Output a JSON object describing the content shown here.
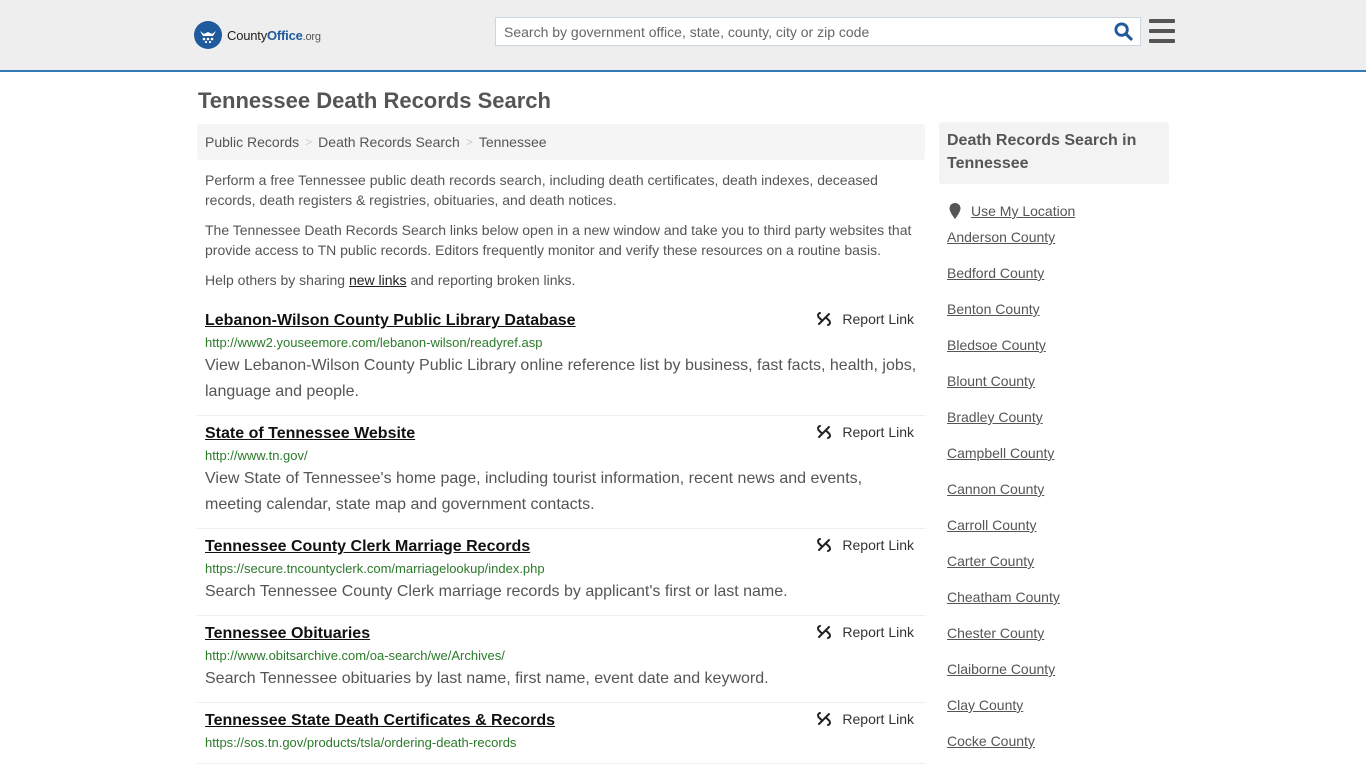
{
  "header": {
    "logo": {
      "name": "County",
      "bold": "Office",
      "tld": ".org"
    },
    "search": {
      "placeholder": "Search by government office, state, county, city or zip code",
      "value": ""
    }
  },
  "page_title": "Tennessee Death Records Search",
  "breadcrumb": [
    {
      "label": "Public Records"
    },
    {
      "label": "Death Records Search"
    },
    {
      "label": "Tennessee"
    }
  ],
  "intro": {
    "p1": "Perform a free Tennessee public death records search, including death certificates, death indexes, deceased records, death registers & registries, obituaries, and death notices.",
    "p2": "The Tennessee Death Records Search links below open in a new window and take you to third party websites that provide access to TN public records. Editors frequently monitor and verify these resources on a routine basis.",
    "p3_before": "Help others by sharing ",
    "p3_link": "new links",
    "p3_after": " and reporting broken links."
  },
  "report_label": "Report Link",
  "results": [
    {
      "title": "Lebanon-Wilson County Public Library Database",
      "url": "http://www2.youseemore.com/lebanon-wilson/readyref.asp",
      "desc": "View Lebanon-Wilson County Public Library online reference list by business, fast facts, health, jobs, language and people."
    },
    {
      "title": "State of Tennessee Website",
      "url": "http://www.tn.gov/",
      "desc": "View State of Tennessee's home page, including tourist information, recent news and events, meeting calendar, state map and government contacts."
    },
    {
      "title": "Tennessee County Clerk Marriage Records",
      "url": "https://secure.tncountyclerk.com/marriagelookup/index.php",
      "desc": "Search Tennessee County Clerk marriage records by applicant's first or last name."
    },
    {
      "title": "Tennessee Obituaries",
      "url": "http://www.obitsarchive.com/oa-search/we/Archives/",
      "desc": "Search Tennessee obituaries by last name, first name, event date and keyword."
    },
    {
      "title": "Tennessee State Death Certificates & Records",
      "url": "https://sos.tn.gov/products/tsla/ordering-death-records",
      "desc": ""
    }
  ],
  "sidebar": {
    "heading": "Death Records Search in Tennessee",
    "use_location": "Use My Location",
    "counties": [
      "Anderson County",
      "Bedford County",
      "Benton County",
      "Bledsoe County",
      "Blount County",
      "Bradley County",
      "Campbell County",
      "Cannon County",
      "Carroll County",
      "Carter County",
      "Cheatham County",
      "Chester County",
      "Claiborne County",
      "Clay County",
      "Cocke County"
    ]
  }
}
